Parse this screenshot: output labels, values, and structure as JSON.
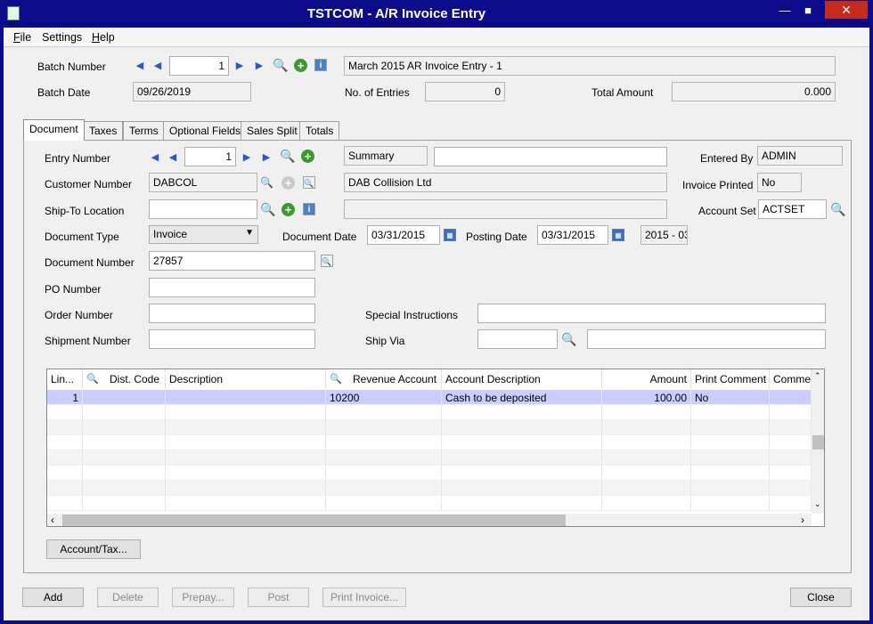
{
  "window": {
    "title": "TSTCOM - A/R Invoice Entry"
  },
  "menu": [
    "File",
    "Settings",
    "Help"
  ],
  "batch": {
    "number_label": "Batch Number",
    "number": "1",
    "description": "March 2015 AR Invoice Entry - 1",
    "date_label": "Batch Date",
    "date": "09/26/2019",
    "entries_label": "No. of Entries",
    "entries": "0",
    "total_label": "Total Amount",
    "total": "0.000"
  },
  "tabs": [
    "Document",
    "Taxes",
    "Terms",
    "Optional Fields",
    "Sales Split",
    "Totals"
  ],
  "document": {
    "entry_number_label": "Entry Number",
    "entry_number": "1",
    "summary_label": "Summary",
    "summary": "",
    "entered_by_label": "Entered By",
    "entered_by": "ADMIN",
    "customer_number_label": "Customer Number",
    "customer_number": "DABCOL",
    "customer_name": "DAB Collision Ltd",
    "invoice_printed_label": "Invoice Printed",
    "invoice_printed": "No",
    "ship_to_label": "Ship-To Location",
    "ship_to": "",
    "ship_to_desc": "",
    "account_set_label": "Account Set",
    "account_set": "ACTSET",
    "doc_type_label": "Document Type",
    "doc_type": "Invoice",
    "doc_date_label": "Document Date",
    "doc_date": "03/31/2015",
    "posting_date_label": "Posting Date",
    "posting_date": "03/31/2015",
    "period": "2015 - 03",
    "doc_number_label": "Document Number",
    "doc_number": "27857",
    "po_label": "PO Number",
    "po": "",
    "order_label": "Order Number",
    "order": "",
    "special_label": "Special Instructions",
    "special": "",
    "shipment_label": "Shipment Number",
    "shipment": "",
    "ship_via_label": "Ship Via",
    "ship_via": "",
    "ship_via_desc": ""
  },
  "grid": {
    "columns": [
      "Lin...",
      "Dist. Code",
      "Description",
      "Revenue Account",
      "Account Description",
      "Amount",
      "Print Comment",
      "Commen"
    ],
    "rows": [
      [
        "1",
        "",
        "",
        "10200",
        "Cash to be deposited",
        "100.00",
        "No",
        ""
      ]
    ]
  },
  "buttons": {
    "account_tax": "Account/Tax...",
    "add": "Add",
    "delete": "Delete",
    "prepay": "Prepay...",
    "post": "Post",
    "print": "Print Invoice...",
    "close": "Close"
  }
}
